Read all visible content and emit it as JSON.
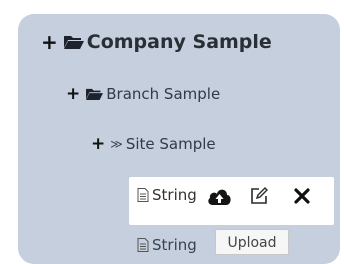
{
  "tree": {
    "company": {
      "toggle": "+",
      "label": "Company Sample"
    },
    "branch": {
      "toggle": "+",
      "label": "Branch Sample"
    },
    "site": {
      "toggle": "+",
      "chevron": "≫",
      "label": "Site Sample"
    },
    "leaves": [
      {
        "label": "String",
        "actions": [
          "cloud-upload-icon",
          "edit-icon",
          "close-icon"
        ]
      },
      {
        "label": "String"
      }
    ]
  },
  "tooltip": {
    "text": "Upload"
  },
  "colors": {
    "panel": "#c5cfde",
    "highlight": "#ffffff",
    "text": "#2f3b4a"
  }
}
